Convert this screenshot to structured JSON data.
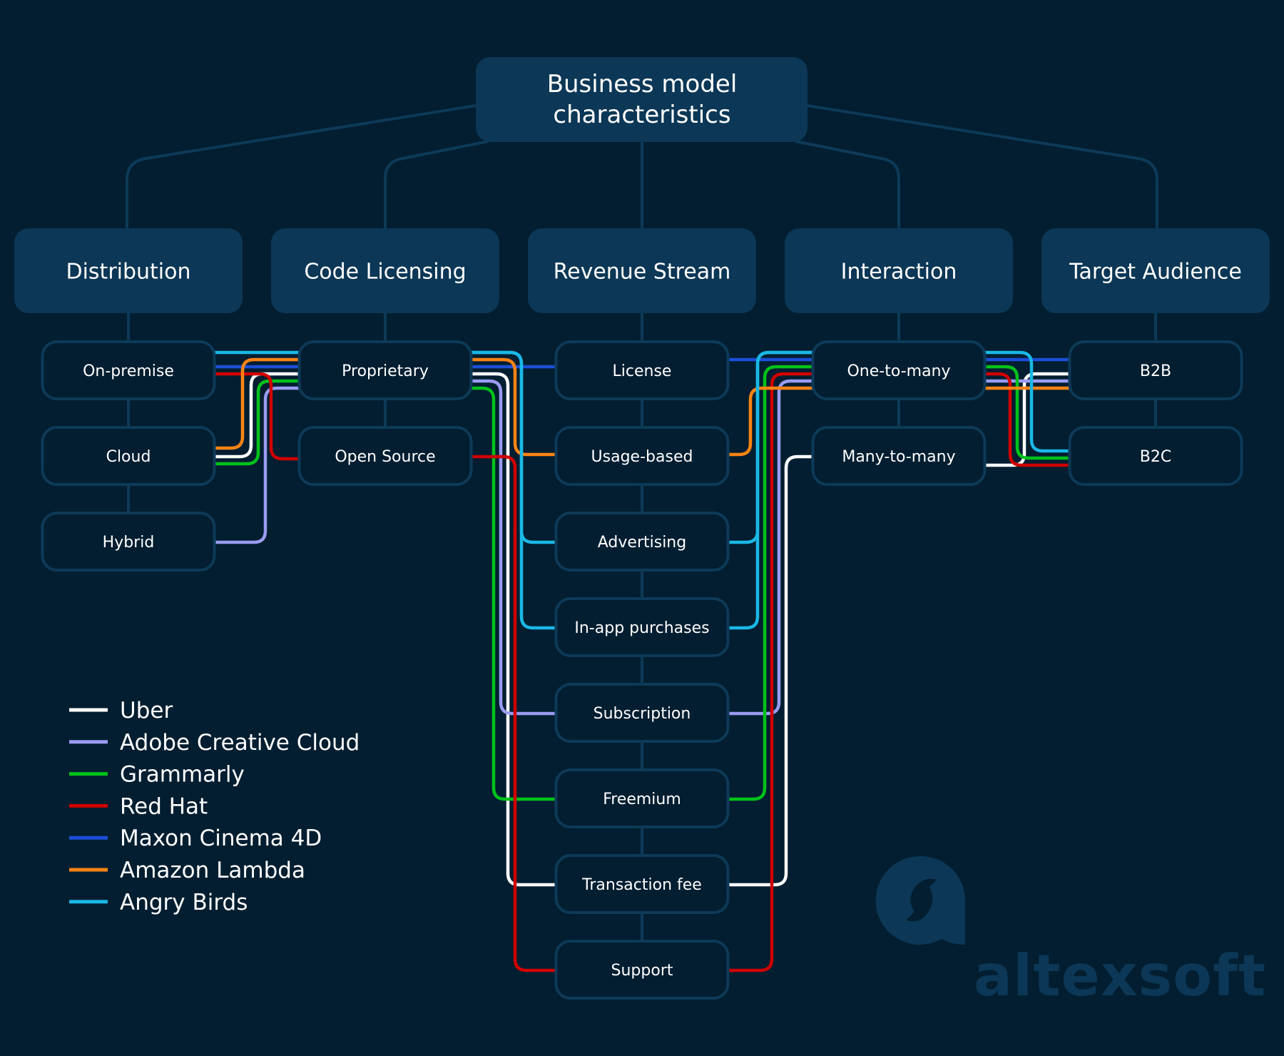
{
  "title": "Business model characteristics",
  "title_lines": [
    "Business model",
    "characteristics"
  ],
  "categories": [
    {
      "id": "distribution",
      "label": "Distribution",
      "options": [
        "On-premise",
        "Cloud",
        "Hybrid"
      ]
    },
    {
      "id": "code-licensing",
      "label": "Code Licensing",
      "options": [
        "Proprietary",
        "Open Source"
      ]
    },
    {
      "id": "revenue-stream",
      "label": "Revenue Stream",
      "options": [
        "License",
        "Usage-based",
        "Advertising",
        "In-app purchases",
        "Subscription",
        "Freemium",
        "Transaction fee",
        "Support"
      ]
    },
    {
      "id": "interaction",
      "label": "Interaction",
      "options": [
        "One-to-many",
        "Many-to-many"
      ]
    },
    {
      "id": "target-audience",
      "label": "Target Audience",
      "options": [
        "B2B",
        "B2C"
      ]
    }
  ],
  "products": [
    {
      "name": "Uber",
      "color": "#ffffff",
      "path": [
        "Cloud",
        "Proprietary",
        "Transaction fee",
        "Many-to-many",
        "B2B"
      ]
    },
    {
      "name": "Adobe Creative Cloud",
      "color": "#9b9bf2",
      "path": [
        "Hybrid",
        "Proprietary",
        "Subscription",
        "One-to-many",
        "B2B"
      ]
    },
    {
      "name": "Grammarly",
      "color": "#00c21a",
      "path": [
        "Cloud",
        "Proprietary",
        "Freemium",
        "One-to-many",
        "B2C"
      ]
    },
    {
      "name": "Red Hat",
      "color": "#d10000",
      "path": [
        "On-premise",
        "Open Source",
        "Support",
        "One-to-many",
        "B2C"
      ]
    },
    {
      "name": "Maxon Cinema 4D",
      "color": "#1c4fd6",
      "path": [
        "On-premise",
        "Proprietary",
        "License",
        "One-to-many",
        "B2B"
      ]
    },
    {
      "name": "Amazon Lambda",
      "color": "#ff8414",
      "path": [
        "Cloud",
        "Proprietary",
        "Usage-based",
        "One-to-many",
        "B2B"
      ]
    },
    {
      "name": "Angry Birds",
      "color": "#1ab8e6",
      "path": [
        "On-premise",
        "Proprietary",
        "Advertising",
        "In-app purchases",
        "One-to-many",
        "B2C"
      ]
    }
  ],
  "legend": [
    {
      "label": "Uber",
      "color": "#ffffff"
    },
    {
      "label": "Adobe Creative Cloud",
      "color": "#9b9bf2"
    },
    {
      "label": "Grammarly",
      "color": "#00c21a"
    },
    {
      "label": "Red Hat",
      "color": "#d10000"
    },
    {
      "label": "Maxon Cinema 4D",
      "color": "#1c4fd6"
    },
    {
      "label": "Amazon Lambda",
      "color": "#ff8414"
    },
    {
      "label": "Angry Birds",
      "color": "#1ab8e6"
    }
  ],
  "brand": {
    "name": "altexsoft"
  },
  "colors": {
    "background": "#021e30",
    "box_fill": "#0c3756",
    "box_border": "#0d3a58"
  }
}
